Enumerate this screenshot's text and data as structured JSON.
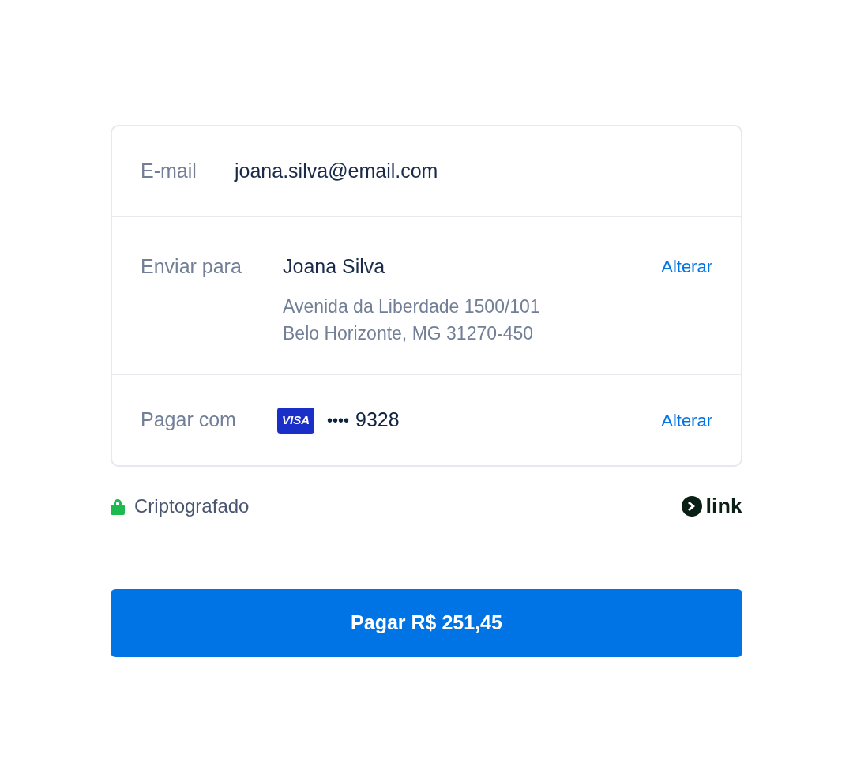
{
  "summary": {
    "rows": [
      {
        "kind": "email",
        "label": "E-mail",
        "value": "joana.silva@email.com"
      },
      {
        "kind": "shipping",
        "label": "Enviar para",
        "name": "Joana Silva",
        "address_lines": [
          "Avenida da Liberdade 1500/101",
          "Belo Horizonte, MG 31270-450"
        ],
        "action": "Alterar"
      },
      {
        "kind": "payment",
        "label": "Pagar com",
        "card_brand": "VISA",
        "mask": "••••",
        "last4": "9328",
        "action": "Alterar"
      }
    ]
  },
  "security": {
    "label": "Criptografado",
    "brand": "link"
  },
  "pay_button": {
    "label": "Pagar R$ 251,45"
  }
}
